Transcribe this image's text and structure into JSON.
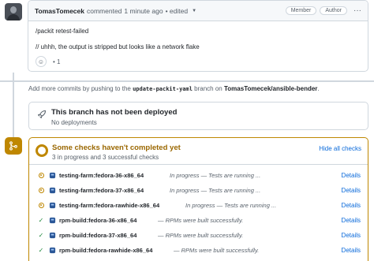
{
  "comment": {
    "author": "TomasTomecek",
    "action": "commented",
    "time": "1 minute ago",
    "edited": "• edited",
    "badges": [
      "Member",
      "Author"
    ],
    "lines": [
      "/packit retest-failed",
      "// uhhh, the output is stripped but looks like a network flake"
    ],
    "reaction_count": "1"
  },
  "push_hint": {
    "prefix": "Add more commits by pushing to the",
    "branch": "update-packit-yaml",
    "middle": "branch on",
    "repo": "TomasTomecek/ansible-bender",
    "suffix": "."
  },
  "deployment": {
    "title": "This branch has not been deployed",
    "subtitle": "No deployments"
  },
  "checks": {
    "title": "Some checks haven't completed yet",
    "subtitle": "3 in progress and 3 successful checks",
    "hide_all": "Hide all checks",
    "colors": {
      "pending": "#bf8700",
      "success": "#1f883d",
      "link": "#0969da"
    },
    "items": [
      {
        "status": "pending",
        "name": "testing-farm:fedora-36-x86_64",
        "description": "In progress — Tests are running ...",
        "action": "Details"
      },
      {
        "status": "pending",
        "name": "testing-farm:fedora-37-x86_64",
        "description": "In progress — Tests are running ...",
        "action": "Details"
      },
      {
        "status": "pending",
        "name": "testing-farm:fedora-rawhide-x86_64",
        "description": "In progress — Tests are running ...",
        "action": "Details"
      },
      {
        "status": "success",
        "name": "rpm-build:fedora-36-x86_64",
        "description": "— RPMs were built successfully.",
        "action": "Details"
      },
      {
        "status": "success",
        "name": "rpm-build:fedora-37-x86_64",
        "description": "— RPMs were built successfully.",
        "action": "Details"
      },
      {
        "status": "success",
        "name": "rpm-build:fedora-rawhide-x86_64",
        "description": "— RPMs were built successfully.",
        "action": "Details"
      }
    ]
  }
}
